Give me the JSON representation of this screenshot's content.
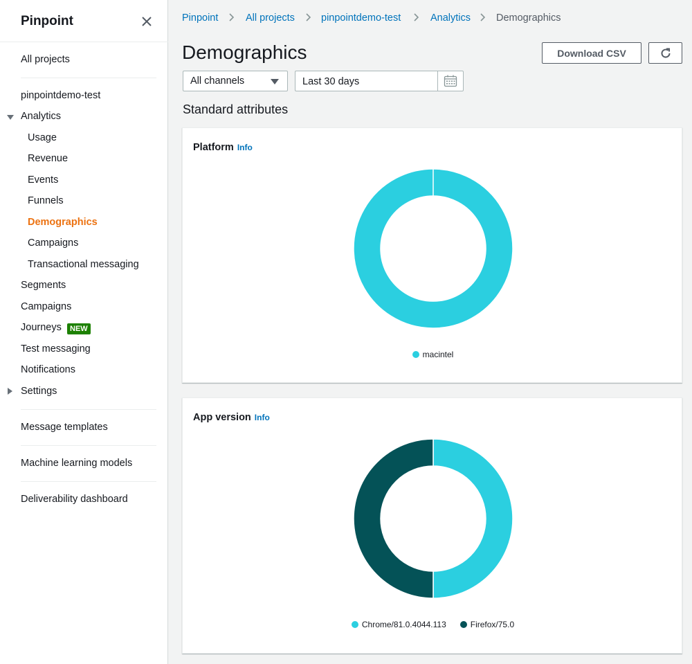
{
  "sidebar": {
    "title": "Pinpoint",
    "all_projects": "All projects",
    "project": "pinpointdemo-test",
    "analytics": "Analytics",
    "analytics_items": [
      "Usage",
      "Revenue",
      "Events",
      "Funnels",
      "Demographics",
      "Campaigns",
      "Transactional messaging"
    ],
    "active_item": "Demographics",
    "segments": "Segments",
    "campaigns": "Campaigns",
    "journeys": "Journeys",
    "journeys_badge": "NEW",
    "test_messaging": "Test messaging",
    "notifications": "Notifications",
    "settings": "Settings",
    "message_templates": "Message templates",
    "ml_models": "Machine learning models",
    "deliverability": "Deliverability dashboard"
  },
  "breadcrumb": [
    "Pinpoint",
    "All projects",
    "pinpointdemo-test",
    "Analytics",
    "Demographics"
  ],
  "page": {
    "title": "Demographics",
    "download_label": "Download CSV",
    "channel_select": "All channels",
    "date_range": "Last 30 days",
    "section_title": "Standard attributes"
  },
  "colors": {
    "accent": "#ec7211",
    "link": "#0073bb",
    "series_cyan": "#2bcfe0",
    "series_teal": "#045257",
    "badge_green": "#1d8102"
  },
  "chart_data": [
    {
      "type": "pie",
      "title": "Platform",
      "info_label": "Info",
      "categories": [
        "macintel"
      ],
      "values": [
        100
      ],
      "colors": [
        "#2bcfe0"
      ]
    },
    {
      "type": "pie",
      "title": "App version",
      "info_label": "Info",
      "categories": [
        "Chrome/81.0.4044.113",
        "Firefox/75.0"
      ],
      "values": [
        50,
        50
      ],
      "colors": [
        "#2bcfe0",
        "#045257"
      ]
    }
  ]
}
